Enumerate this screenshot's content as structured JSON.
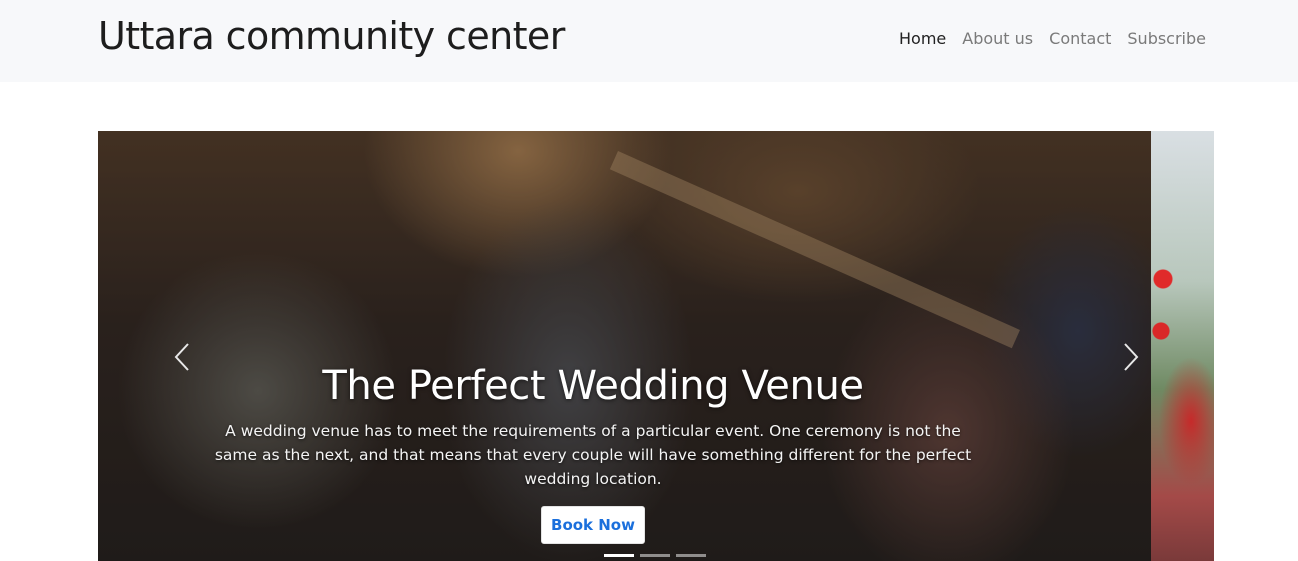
{
  "header": {
    "brand": "Uttara community center",
    "nav": [
      {
        "label": "Home",
        "active": true
      },
      {
        "label": "About us",
        "active": false
      },
      {
        "label": "Contact",
        "active": false
      },
      {
        "label": "Subscribe",
        "active": false
      }
    ]
  },
  "carousel": {
    "slide": {
      "title": "The Perfect Wedding Venue",
      "text": "A wedding venue has to meet the requirements of a particular event. One ceremony is not the same as the next, and that means that every couple will have something different for the perfect wedding location.",
      "button_label": "Book Now"
    },
    "prev_icon": "chevron-left-icon",
    "next_icon": "chevron-right-icon",
    "indicators": 3,
    "active_indicator": 0
  },
  "colors": {
    "navbar_bg": "#f7f8fa",
    "button_text": "#1a6fdc",
    "nav_active": "#222222",
    "nav_inactive": "#7a7a7a"
  }
}
